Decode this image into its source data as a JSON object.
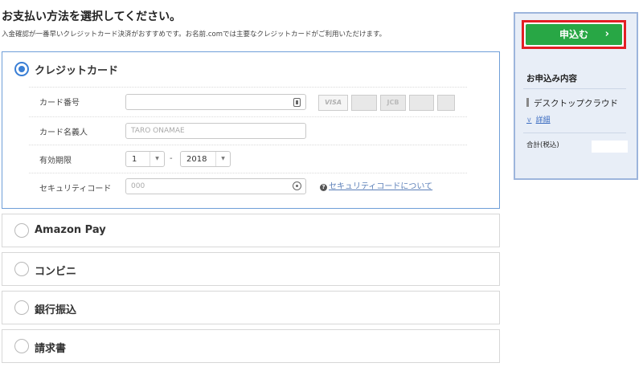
{
  "header": {
    "title": "お支払い方法を選択してください。",
    "subtitle": "入金確認が一番早いクレジットカード決済がおすすめです。お名前.comでは主要なクレジットカードがご利用いただけます。"
  },
  "payment_methods": [
    {
      "label": "クレジットカード",
      "selected": true
    },
    {
      "label": "Amazon Pay",
      "selected": false
    },
    {
      "label": "コンビニ",
      "selected": false
    },
    {
      "label": "銀行振込",
      "selected": false
    },
    {
      "label": "請求書",
      "selected": false
    }
  ],
  "credit_form": {
    "card_number_label": "カード番号",
    "card_number_value": "",
    "card_brands": [
      "VISA",
      "",
      "JCB",
      "",
      ""
    ],
    "card_name_label": "カード名義人",
    "card_name_placeholder": "TARO ONAMAE",
    "expiry_label": "有効期限",
    "expiry_month": "1",
    "expiry_separator": "-",
    "expiry_year": "2018",
    "security_label": "セキュリティコード",
    "security_placeholder": "000",
    "security_help": "セキュリティコードについて",
    "security_help_icon": "?"
  },
  "sidebar": {
    "apply_label": "申込む",
    "apply_chevron": "›",
    "summary_title": "お申込み内容",
    "item": "デスクトップクラウド",
    "detail_chevron": "∨",
    "detail_link": "詳細",
    "total_label": "合計(税込)",
    "total_value": "",
    "accent_color": "#28a745",
    "highlight_color": "#e31e24"
  }
}
